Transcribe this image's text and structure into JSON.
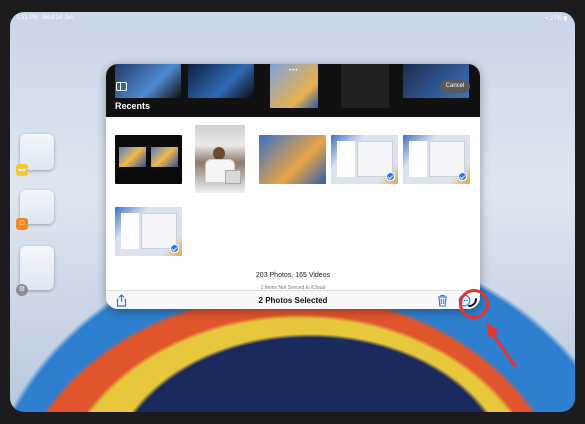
{
  "status": {
    "time": "1:31 PM",
    "date": "Wed 14 Jun",
    "battery": "27%"
  },
  "photos": {
    "section_title": "Recents",
    "cancel_label": "Cancel",
    "counts": "203 Photos, 165 Videos",
    "subcount": "1 Items Not Synced to iCloud",
    "selected_label": "2 Photos Selected"
  },
  "icons": {
    "sidebar": "sidebar-icon",
    "share": "share-icon",
    "trash": "trash-icon",
    "more": "ellipsis-circle-icon",
    "annotation": "red-arrow-and-circle"
  },
  "colors": {
    "accent": "#1f78ff",
    "annotation": "#e8322e"
  }
}
